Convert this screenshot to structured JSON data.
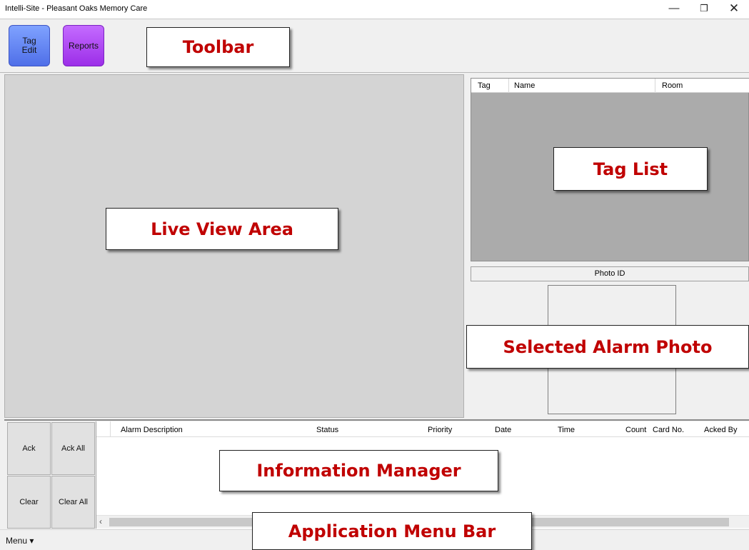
{
  "window": {
    "title": "Intelli-Site - Pleasant Oaks Memory Care",
    "minimize_glyph": "—",
    "maximize_glyph": "❐",
    "close_glyph": "✕"
  },
  "toolbar": {
    "tag_edit_label": "Tag\nEdit",
    "reports_label": "Reports"
  },
  "callouts": {
    "toolbar": "Toolbar",
    "live_view": "Live View Area",
    "tag_list": "Tag List",
    "selected_alarm_photo": "Selected Alarm Photo",
    "information_manager": "Information Manager",
    "application_menu_bar": "Application Menu Bar"
  },
  "tag_list": {
    "columns": [
      "Tag",
      "Name",
      "Room"
    ]
  },
  "photo": {
    "label": "Photo ID"
  },
  "actions": {
    "ack": "Ack",
    "ack_all": "Ack All",
    "clear": "Clear",
    "clear_all": "Clear All"
  },
  "alarm_grid": {
    "columns": [
      "Alarm Description",
      "Status",
      "Priority",
      "Date",
      "Time",
      "Count",
      "Card No.",
      "Acked By"
    ]
  },
  "menubar": {
    "menu_label": "Menu ▾"
  },
  "colors": {
    "callout_text": "#c00000",
    "tag_edit_button": "#5f82f5",
    "reports_button": "#a93cf0"
  }
}
